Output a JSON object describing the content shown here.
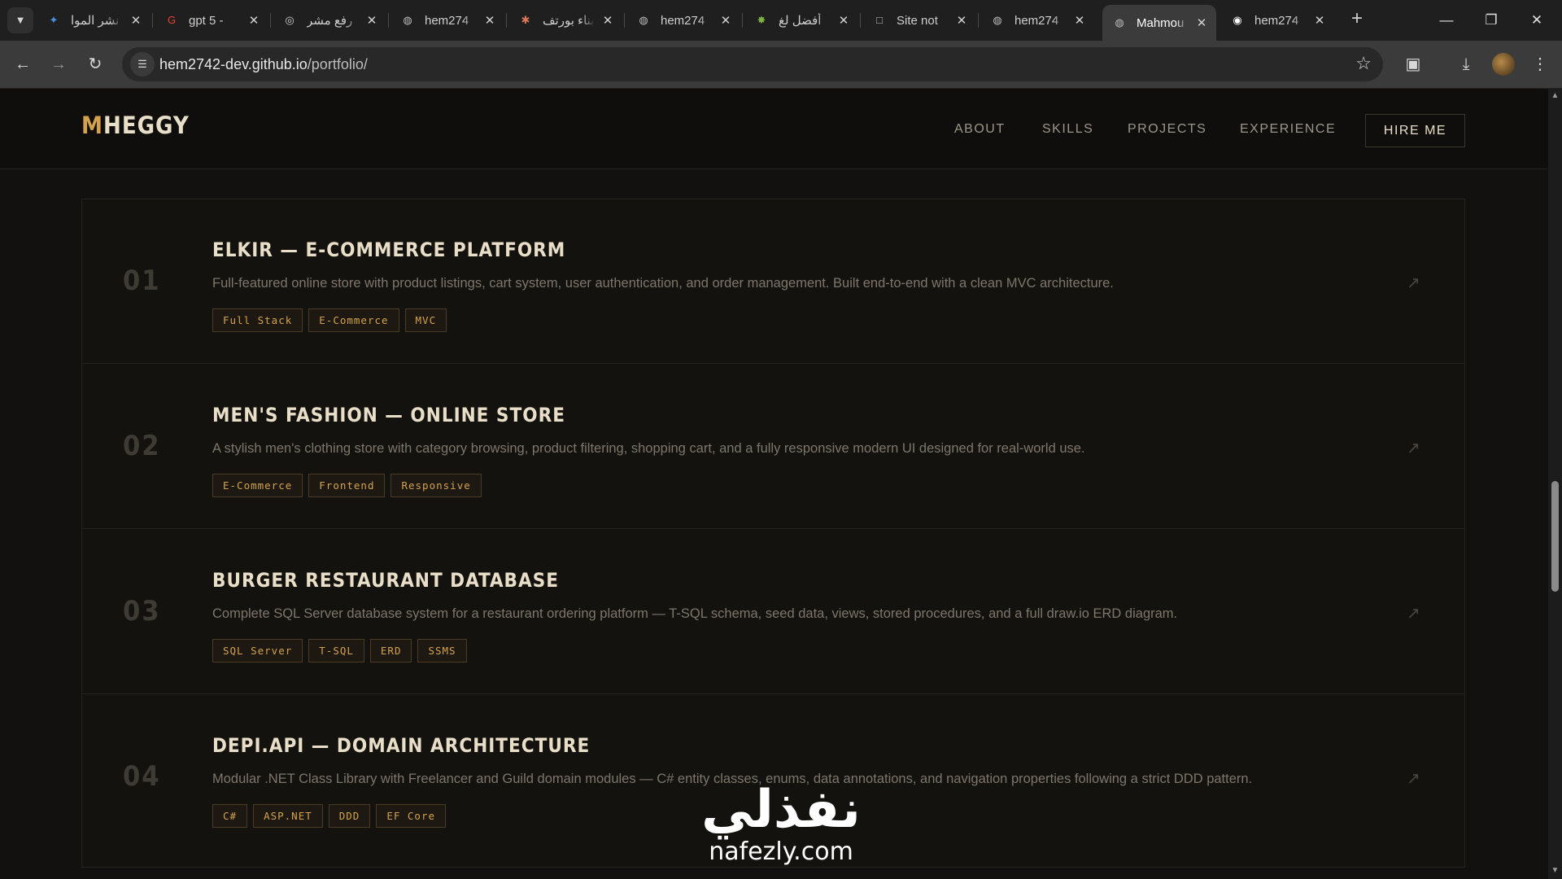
{
  "browser": {
    "tabs": [
      {
        "title": "نشر الموا",
        "favicon": "gemini-icon",
        "color": "#4a90e2"
      },
      {
        "title": "gpt 5 - ",
        "favicon": "google-icon",
        "color": "#ea4335"
      },
      {
        "title": "رفع مشر",
        "favicon": "chatgpt-icon",
        "color": "#d0d0d0"
      },
      {
        "title": "hem274",
        "favicon": "globe-icon",
        "color": "#bdbdbd"
      },
      {
        "title": "بناء بورتف",
        "favicon": "claude-icon",
        "color": "#d97757"
      },
      {
        "title": "hem274",
        "favicon": "globe-icon",
        "color": "#bdbdbd"
      },
      {
        "title": "أفضل لغ",
        "favicon": "pinwheel-icon",
        "color": "#7cb342"
      },
      {
        "title": "Site not",
        "favicon": "page-icon",
        "color": "#bdbdbd"
      },
      {
        "title": "hem274",
        "favicon": "globe-icon",
        "color": "#bdbdbd"
      },
      {
        "title": "Mahmou",
        "favicon": "globe-icon",
        "color": "#bdbdbd",
        "active": true
      },
      {
        "title": "hem274",
        "favicon": "github-icon",
        "color": "#ffffff"
      }
    ],
    "url": {
      "host": "hem2742-dev.github.io",
      "path": "/portfolio/"
    }
  },
  "site": {
    "logo_accent": "M",
    "logo_rest": "HEGGY",
    "nav": [
      "ABOUT",
      "SKILLS",
      "PROJECTS",
      "EXPERIENCE"
    ],
    "hire_label": "HIRE ME",
    "accent_color": "#d4a24c"
  },
  "projects": [
    {
      "number": "01",
      "title": "ELKIR — E-COMMERCE PLATFORM",
      "description": "Full-featured online store with product listings, cart system, user authentication, and order management. Built end-to-end with a clean MVC architecture.",
      "tags": [
        "Full Stack",
        "E-Commerce",
        "MVC"
      ]
    },
    {
      "number": "02",
      "title": "MEN'S FASHION — ONLINE STORE",
      "description": "A stylish men's clothing store with category browsing, product filtering, shopping cart, and a fully responsive modern UI designed for real-world use.",
      "tags": [
        "E-Commerce",
        "Frontend",
        "Responsive"
      ]
    },
    {
      "number": "03",
      "title": "BURGER RESTAURANT DATABASE",
      "description": "Complete SQL Server database system for a restaurant ordering platform — T-SQL schema, seed data, views, stored procedures, and a full draw.io ERD diagram.",
      "tags": [
        "SQL Server",
        "T-SQL",
        "ERD",
        "SSMS"
      ]
    },
    {
      "number": "04",
      "title": "DEPI.API — DOMAIN ARCHITECTURE",
      "description": "Modular .NET Class Library with Freelancer and Guild domain modules — C# entity classes, enums, data annotations, and navigation properties following a strict DDD pattern.",
      "tags": [
        "C#",
        "ASP.NET",
        "DDD",
        "EF Core"
      ]
    }
  ],
  "watermark": {
    "arabic": "نفذلي",
    "latin": "nafezly.com"
  }
}
